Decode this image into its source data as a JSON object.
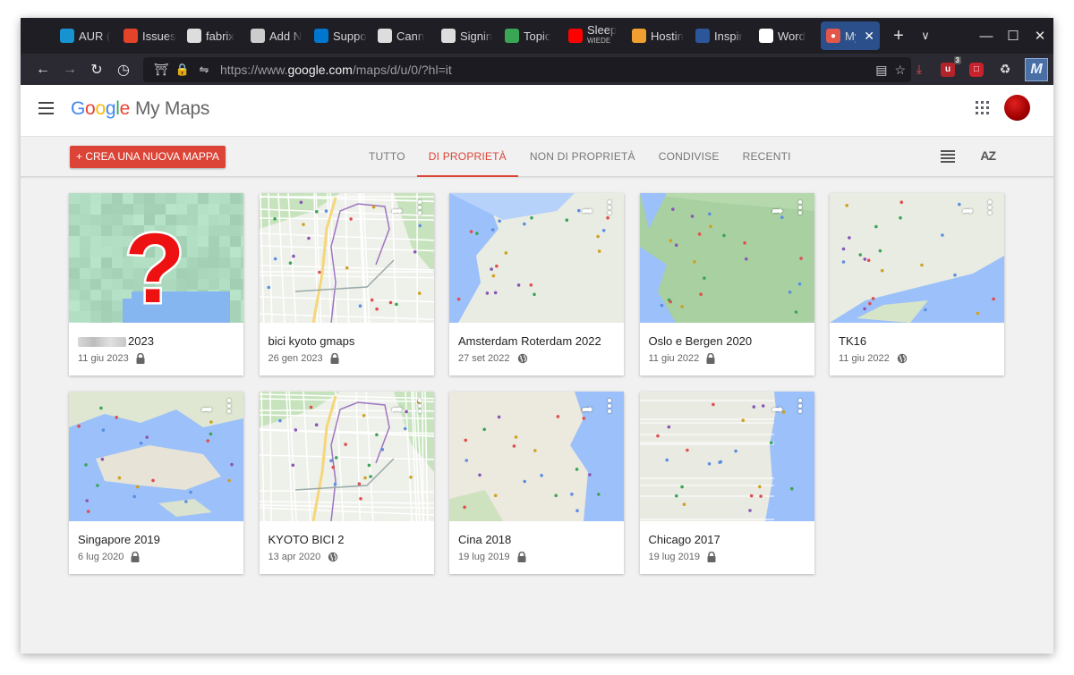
{
  "browser": {
    "tabs": [
      {
        "label": "AUR (",
        "icon": "arch-icon",
        "color": "#1793d1"
      },
      {
        "label": "Issues",
        "icon": "gitlab-icon",
        "color": "#e24329"
      },
      {
        "label": "fabrix",
        "icon": "wordpress-icon",
        "color": "#dddddd"
      },
      {
        "label": "Add N",
        "icon": "rss-icon",
        "color": "#cccccc"
      },
      {
        "label": "Suppo",
        "icon": "dell-icon",
        "color": "#0076ce"
      },
      {
        "label": "Cann",
        "icon": "gnu-icon",
        "color": "#dddddd"
      },
      {
        "label": "Signin",
        "icon": "gnu-icon",
        "color": "#dddddd"
      },
      {
        "label": "Topic",
        "icon": "forum-icon",
        "color": "#3aa655"
      },
      {
        "label": "Sleep",
        "sub": "WIEDE",
        "icon": "youtube-icon",
        "color": "#ff0000"
      },
      {
        "label": "Hostin",
        "icon": "hosting-icon",
        "color": "#f0a030"
      },
      {
        "label": "Inspir",
        "icon": "word-icon",
        "color": "#2b579a"
      },
      {
        "label": "Word",
        "icon": "google-icon",
        "color": "#ffffff"
      }
    ],
    "active_tab": {
      "label": "My",
      "icon": "mymaps-icon"
    },
    "url_prefix": "https://www.",
    "url_domain": "google.com",
    "url_path": "/maps/d/u/0/?hl=it",
    "ext_badge_count": "3"
  },
  "app": {
    "logo_google": [
      "G",
      "o",
      "o",
      "g",
      "l",
      "e"
    ],
    "product": "My Maps",
    "create_button": "+ CREA UNA NUOVA MAPPA",
    "filter_tabs": [
      "TUTTO",
      "DI PROPRIETÀ",
      "NON DI PROPRIETÀ",
      "CONDIVISE",
      "RECENTI"
    ],
    "active_filter": "DI PROPRIETÀ",
    "sort_label": "AZ"
  },
  "maps": [
    {
      "title": "2023",
      "title_blurred": true,
      "date": "11 giu 2023",
      "visibility": "private",
      "thumb": "blurred"
    },
    {
      "title": "bici kyoto gmaps",
      "date": "26 gen 2023",
      "visibility": "private",
      "thumb": "city"
    },
    {
      "title": "Amsterdam Roterdam 2022",
      "date": "27 set 2022",
      "visibility": "public",
      "thumb": "coast"
    },
    {
      "title": "Oslo e Bergen 2020",
      "date": "11 giu 2022",
      "visibility": "private",
      "thumb": "forest"
    },
    {
      "title": "TK16",
      "date": "11 giu 2022",
      "visibility": "public",
      "thumb": "coast2"
    },
    {
      "title": "Singapore 2019",
      "date": "6 lug 2020",
      "visibility": "private",
      "thumb": "island"
    },
    {
      "title": "KYOTO BICI 2",
      "date": "13 apr 2020",
      "visibility": "public",
      "thumb": "city2"
    },
    {
      "title": "Cina 2018",
      "date": "19 lug 2019",
      "visibility": "private",
      "thumb": "land"
    },
    {
      "title": "Chicago 2017",
      "date": "19 lug 2019",
      "visibility": "private",
      "thumb": "lake"
    }
  ],
  "colors": {
    "accent": "#db4437",
    "map_water": "#9cc0f9",
    "map_land": "#e8eadf",
    "map_park": "#c5e5c0"
  }
}
